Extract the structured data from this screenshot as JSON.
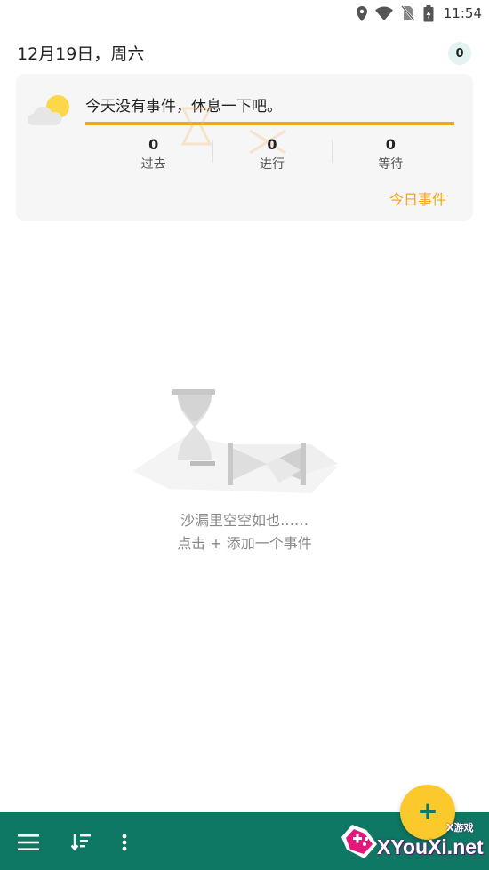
{
  "status_bar": {
    "time": "11:54",
    "icons": [
      "location-icon",
      "wifi-icon",
      "no-sim-icon",
      "battery-icon"
    ]
  },
  "header": {
    "date": "12月19日，周六",
    "badge_count": "0"
  },
  "today_card": {
    "message": "今天没有事件，休息一下吧。",
    "progress_fraction": 1.0,
    "stats": [
      {
        "value": "0",
        "label": "过去"
      },
      {
        "value": "0",
        "label": "进行"
      },
      {
        "value": "0",
        "label": "等待"
      }
    ],
    "link_label": "今日事件",
    "weather_icon": "partly-cloudy-icon"
  },
  "empty_state": {
    "line1": "沙漏里空空如也……",
    "line2": "点击 + 添加一个事件"
  },
  "bottom_bar": {
    "icons": [
      "menu-icon",
      "sort-icon",
      "more-vert-icon"
    ],
    "fab_label": "+"
  },
  "corner_logo": {
    "text": "XYouXi.net",
    "subtext": "X游戏"
  },
  "colors": {
    "accent": "#f2a51c",
    "bottom_bar": "#0f7864",
    "fab": "#fbc92c",
    "badge_bg": "#e3f3f1"
  }
}
